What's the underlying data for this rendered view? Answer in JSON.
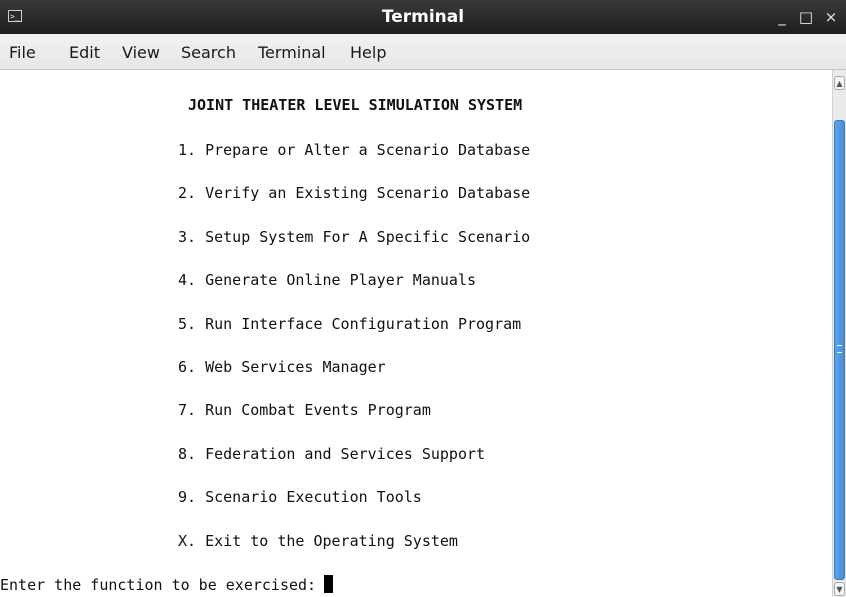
{
  "window": {
    "title": "Terminal",
    "icon": "terminal-icon",
    "minimize_glyph": "_",
    "maximize_glyph": "□",
    "close_glyph": "×"
  },
  "menu": {
    "items": [
      "File",
      "Edit",
      "View",
      "Search",
      "Terminal",
      "Help"
    ]
  },
  "terminal": {
    "heading": "JOINT THEATER LEVEL SIMULATION SYSTEM",
    "options": [
      "1. Prepare or Alter a Scenario Database",
      "2. Verify an Existing Scenario Database",
      "3. Setup System For A Specific Scenario",
      "4. Generate Online Player Manuals",
      "5. Run Interface Configuration Program",
      "6. Web Services Manager",
      "7. Run Combat Events Program",
      "8. Federation and Services Support",
      "9. Scenario Execution Tools",
      "X. Exit to the Operating System"
    ],
    "prompt": "Enter the function to be exercised:"
  },
  "colors": {
    "titlebar": "#1e1e1e",
    "scroll_thumb": "#4a8fd8"
  }
}
